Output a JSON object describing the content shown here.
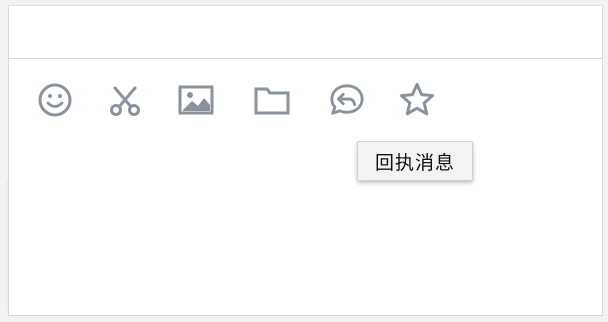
{
  "toolbar": {
    "icons": [
      {
        "name": "emoji-icon",
        "label": "emoji"
      },
      {
        "name": "scissors-icon",
        "label": "screenshot"
      },
      {
        "name": "image-icon",
        "label": "image"
      },
      {
        "name": "folder-icon",
        "label": "file"
      },
      {
        "name": "reply-bubble-icon",
        "label": "reply"
      },
      {
        "name": "star-icon",
        "label": "favorite"
      }
    ],
    "icon_color": "#8a939c"
  },
  "tooltip": {
    "text": "回执消息"
  }
}
